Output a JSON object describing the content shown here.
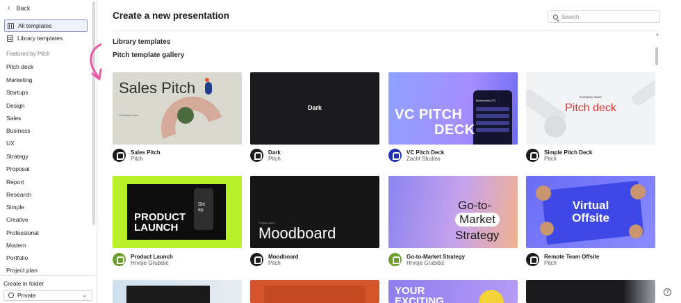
{
  "sidebar": {
    "back_label": "Back",
    "all_templates": "All templates",
    "library_templates": "Library templates",
    "featured_heading": "Featured by Pitch",
    "categories": [
      "Pitch deck",
      "Marketing",
      "Startups",
      "Design",
      "Sales",
      "Business",
      "UX",
      "Strategy",
      "Proposal",
      "Report",
      "Research",
      "Simple",
      "Creative",
      "Professional",
      "Modern",
      "Portfolio",
      "Project plan"
    ],
    "create_folder": "Create in folder",
    "folder_value": "Private"
  },
  "main": {
    "title": "Create a new presentation",
    "search_placeholder": "Search",
    "section_library": "Library templates",
    "section_gallery": "Pitch template gallery"
  },
  "templates": [
    {
      "name": "Sales Pitch",
      "author": "Pitch",
      "thumb_title": "Sales Pitch",
      "thumb_sub": "Company name"
    },
    {
      "name": "Dark",
      "author": "Pitch",
      "thumb_title": "Dark"
    },
    {
      "name": "VC Pitch Deck",
      "author": "Zacht Studios",
      "thumb_title": "VC PITCH",
      "thumb_title2": "DECK",
      "thumb_sub": "Bookmarks (27)"
    },
    {
      "name": "Simple Pitch Deck",
      "author": "Pitch",
      "thumb_title": "Pitch deck",
      "thumb_sub": "Company name"
    },
    {
      "name": "Product Launch",
      "author": "Hrvoje Grubišić",
      "thumb_title": "PRODUCT",
      "thumb_title2": "LAUNCH",
      "thumb_sub": "Sle ep"
    },
    {
      "name": "Moodboard",
      "author": "Pitch",
      "thumb_title": "Moodboard",
      "thumb_sub": "Project name"
    },
    {
      "name": "Go-to-Market Strategy",
      "author": "Hrvoje Grubišić",
      "thumb_title": "Go-to-",
      "thumb_title2": "Market",
      "thumb_title3": "Strategy"
    },
    {
      "name": "Remote Team Offsite",
      "author": "Pitch",
      "thumb_title": "Virtual",
      "thumb_title2": "Offsite"
    }
  ],
  "bottom_row_texts": {
    "card3": "YOUR EXCITING"
  },
  "help_label": "?",
  "colors": {
    "accent": "#8a93c9",
    "arrow": "#e75aa6",
    "lime": "#b8f02a"
  }
}
